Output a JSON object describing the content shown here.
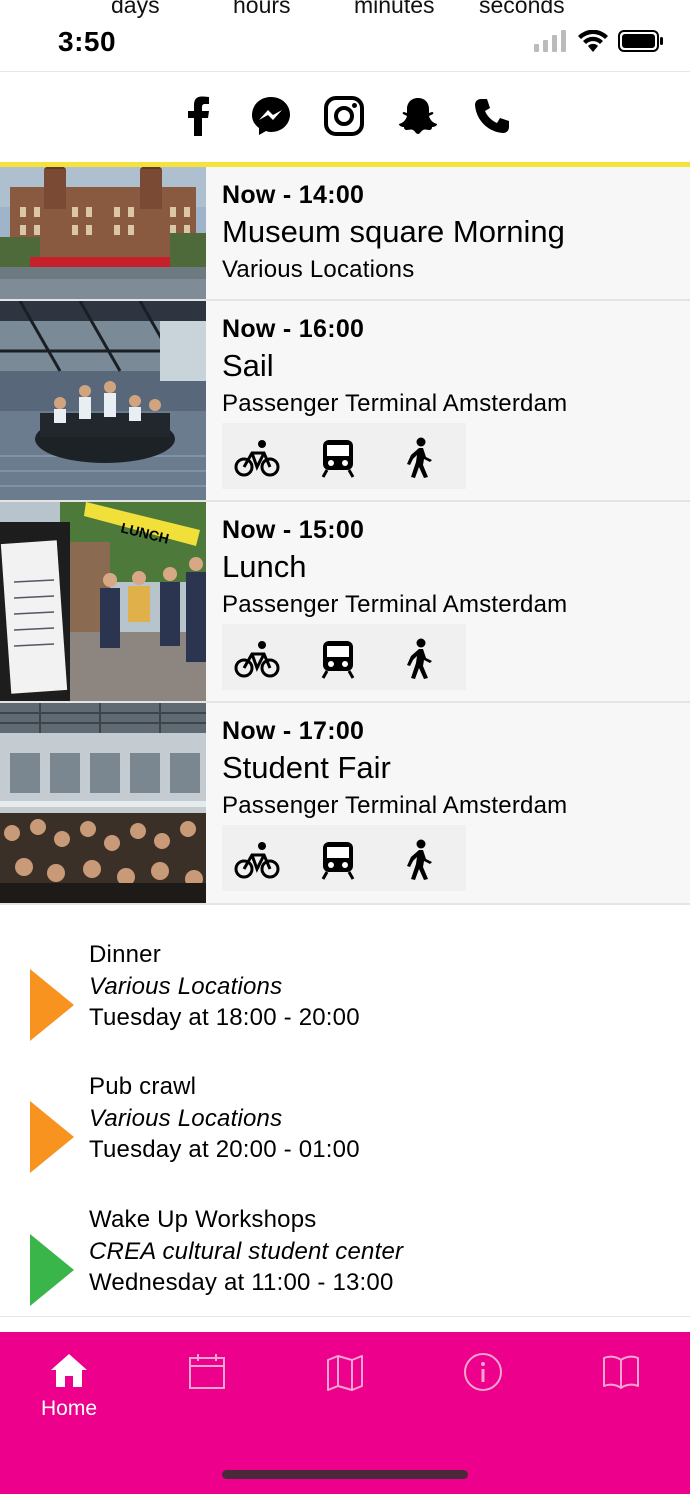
{
  "status_bar": {
    "countdown_labels": [
      "days",
      "hours",
      "minutes",
      "seconds"
    ],
    "time": "3:50"
  },
  "social_icons": [
    "facebook-icon",
    "messenger-icon",
    "instagram-icon",
    "snapchat-icon",
    "phone-icon"
  ],
  "events": [
    {
      "time": "Now - 14:00",
      "title": "Museum square Morning",
      "location": "Various Locations"
    },
    {
      "time": "Now - 16:00",
      "title": "Sail",
      "location": "Passenger Terminal Amsterdam"
    },
    {
      "time": "Now - 15:00",
      "title": "Lunch",
      "location": "Passenger Terminal Amsterdam"
    },
    {
      "time": "Now - 17:00",
      "title": "Student Fair",
      "location": "Passenger Terminal Amsterdam"
    }
  ],
  "transport_icons": [
    "bicycle-icon",
    "train-icon",
    "walking-icon"
  ],
  "photo_texts": {
    "lunch_sign": "LUNCH"
  },
  "upcoming": [
    {
      "name": "Dinner",
      "location": "Various Locations",
      "when": "Tuesday at 18:00 - 20:00",
      "color": "#f7931e"
    },
    {
      "name": "Pub crawl",
      "location": "Various Locations",
      "when": "Tuesday at 20:00 - 01:00",
      "color": "#f7931e"
    },
    {
      "name": "Wake Up Workshops",
      "location": "CREA cultural student center",
      "when": "Wednesday at 11:00 - 13:00",
      "color": "#39b54a"
    }
  ],
  "tabbar": {
    "color": "#ec008c",
    "home_label": "Home",
    "tabs": [
      "home-icon",
      "calendar-icon",
      "map-icon",
      "info-icon",
      "book-icon"
    ]
  },
  "colors": {
    "accent_yellow": "#f5e23c",
    "tabbar": "#ec008c"
  }
}
